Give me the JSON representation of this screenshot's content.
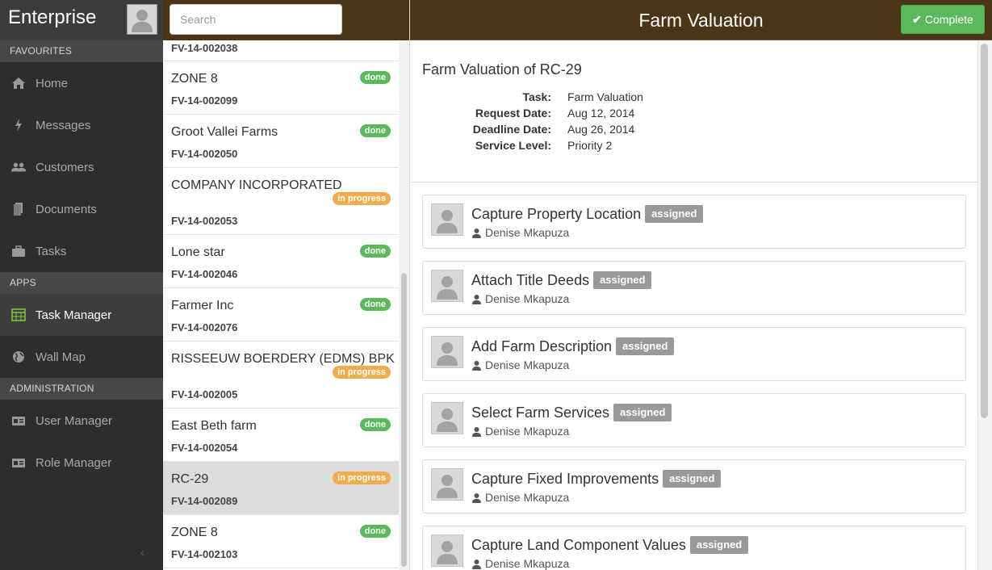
{
  "app": {
    "brand": "Enterprise"
  },
  "sidebar": {
    "sections": [
      {
        "title": "FAVOURITES",
        "items": [
          {
            "label": "Home",
            "icon": "home-icon"
          },
          {
            "label": "Messages",
            "icon": "bolt-icon"
          },
          {
            "label": "Customers",
            "icon": "users-icon"
          },
          {
            "label": "Documents",
            "icon": "file-icon"
          },
          {
            "label": "Tasks",
            "icon": "briefcase-icon"
          }
        ]
      },
      {
        "title": "APPS",
        "items": [
          {
            "label": "Task Manager",
            "icon": "calendar-icon",
            "active": true
          },
          {
            "label": "Wall Map",
            "icon": "globe-icon"
          }
        ]
      },
      {
        "title": "ADMINISTRATION",
        "items": [
          {
            "label": "User Manager",
            "icon": "id-card-icon"
          },
          {
            "label": "Role Manager",
            "icon": "id-card-icon"
          }
        ]
      }
    ],
    "collapse_icon": "chevron-left-icon"
  },
  "search": {
    "placeholder": "Search",
    "value": ""
  },
  "list": {
    "items": [
      {
        "name": "",
        "code": "FV-14-002038",
        "status": ""
      },
      {
        "name": "ZONE 8",
        "code": "FV-14-002099",
        "status": "done"
      },
      {
        "name": "Groot Vallei Farms",
        "code": "FV-14-002050",
        "status": "done"
      },
      {
        "name": "COMPANY INCORPORATED",
        "code": "FV-14-002053",
        "status": "in progress"
      },
      {
        "name": "Lone star",
        "code": "FV-14-002046",
        "status": "done"
      },
      {
        "name": "Farmer Inc",
        "code": "FV-14-002076",
        "status": "done"
      },
      {
        "name": "RISSEEUW BOERDERY (EDMS) BPK",
        "code": "FV-14-002005",
        "status": "in progress"
      },
      {
        "name": "East Beth farm",
        "code": "FV-14-002054",
        "status": "done"
      },
      {
        "name": "RC-29",
        "code": "FV-14-002089",
        "status": "in progress",
        "selected": true
      },
      {
        "name": "ZONE 8",
        "code": "FV-14-002103",
        "status": "done"
      }
    ]
  },
  "detail": {
    "header_title": "Farm Valuation",
    "complete_label": "Complete",
    "summary_title": "Farm Valuation of RC-29",
    "fields": [
      {
        "label": "Task:",
        "value": "Farm Valuation"
      },
      {
        "label": "Request Date:",
        "value": "Aug 12, 2014"
      },
      {
        "label": "Deadline Date:",
        "value": "Aug 26, 2014"
      },
      {
        "label": "Service Level:",
        "value": "Priority 2"
      }
    ],
    "tasks": [
      {
        "title": "Capture Property Location",
        "status": "assigned",
        "assignee": "Denise Mkapuza"
      },
      {
        "title": "Attach Title Deeds",
        "status": "assigned",
        "assignee": "Denise Mkapuza"
      },
      {
        "title": "Add Farm Description",
        "status": "assigned",
        "assignee": "Denise Mkapuza"
      },
      {
        "title": "Select Farm Services",
        "status": "assigned",
        "assignee": "Denise Mkapuza"
      },
      {
        "title": "Capture Fixed Improvements",
        "status": "assigned",
        "assignee": "Denise Mkapuza"
      },
      {
        "title": "Capture Land Component Values",
        "status": "assigned",
        "assignee": "Denise Mkapuza"
      }
    ]
  },
  "colors": {
    "header_brown": "#4a3517",
    "sidebar_dark": "#2d2d2d",
    "done_green": "#5cb85c",
    "progress_orange": "#f0ad4e",
    "assigned_gray": "#999999",
    "active_icon_green": "#8cc63f"
  }
}
